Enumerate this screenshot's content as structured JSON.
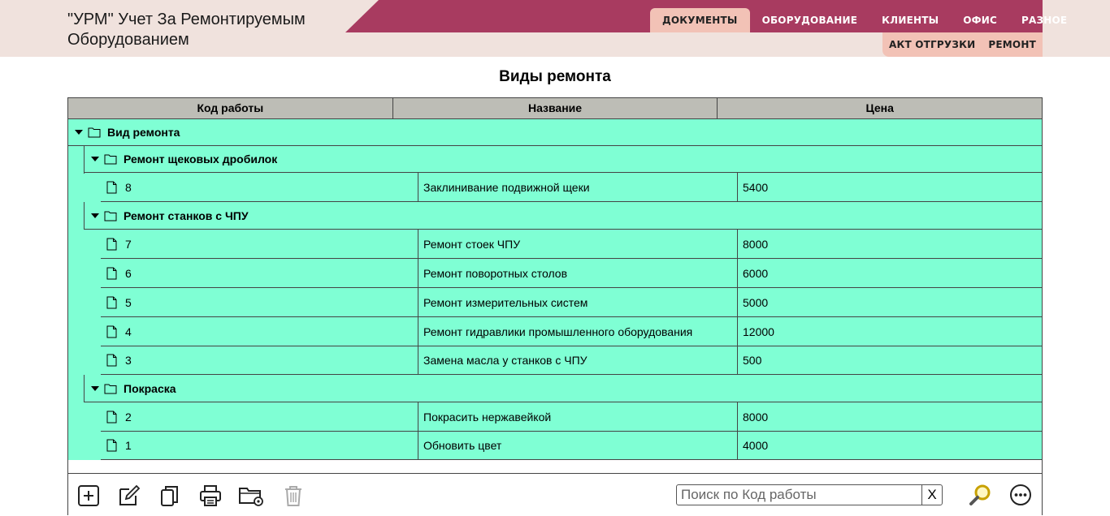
{
  "app": {
    "title_line1": "\"УРМ\" Учет За Ремонтируемым",
    "title_line2": "Оборудованием"
  },
  "nav": {
    "items": [
      {
        "label": "ДОКУМЕНТЫ",
        "active": true
      },
      {
        "label": "ОБОРУДОВАНИЕ"
      },
      {
        "label": "КЛИЕНТЫ"
      },
      {
        "label": "ОФИС"
      },
      {
        "label": "РАЗНОЕ"
      }
    ],
    "sub_items": [
      {
        "label": "АКТ ОТГРУЗКИ"
      },
      {
        "label": "РЕМОНТ"
      }
    ]
  },
  "colors": {
    "header_bg": "#f0e2dd",
    "nav_band": "#a83b60",
    "nav_active": "#f2c2b6",
    "row_bg": "#7fffd4",
    "column_header_bg": "#bdbdb6"
  },
  "page": {
    "title": "Виды ремонта"
  },
  "grid": {
    "columns": [
      "Код работы",
      "Название",
      "Цена"
    ],
    "root": {
      "label": "Вид ремонта"
    },
    "groups": [
      {
        "label": "Ремонт щековых дробилок",
        "rows": [
          {
            "code": "8",
            "name": "Заклинивание подвижной щеки",
            "price": "5400"
          }
        ]
      },
      {
        "label": "Ремонт станков с ЧПУ",
        "rows": [
          {
            "code": "7",
            "name": "Ремонт стоек ЧПУ",
            "price": "8000"
          },
          {
            "code": "6",
            "name": "Ремонт поворотных столов",
            "price": "6000"
          },
          {
            "code": "5",
            "name": "Ремонт измерительных систем",
            "price": "5000"
          },
          {
            "code": "4",
            "name": "Ремонт гидравлики промышленного оборудования",
            "price": "12000"
          },
          {
            "code": "3",
            "name": "Замена масла у станков с ЧПУ",
            "price": "500"
          }
        ]
      },
      {
        "label": "Покраска",
        "rows": [
          {
            "code": "2",
            "name": "Покрасить нержавейкой",
            "price": "8000"
          },
          {
            "code": "1",
            "name": "Обновить цвет",
            "price": "4000"
          }
        ]
      }
    ]
  },
  "toolbar": {
    "icons": [
      "add-icon",
      "edit-icon",
      "copy-icon",
      "print-icon",
      "folder-settings-icon",
      "delete-icon"
    ],
    "search_placeholder": "Поиск по Код работы",
    "clear_label": "X",
    "search_icon": "magnifier-icon",
    "more_icon": "more-icon"
  }
}
